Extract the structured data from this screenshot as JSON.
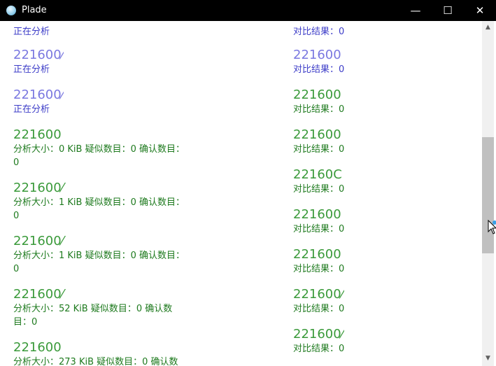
{
  "window": {
    "title": "Plade"
  },
  "colors": {
    "blue": "#3c3cc8",
    "title_blue": "#7a78e0",
    "green": "#1e7a1e",
    "title_green": "#3a9a3a"
  },
  "left_items": [
    {
      "title": "",
      "desc": "正在分析",
      "color": "blue"
    },
    {
      "title": "221600⁄",
      "desc": "正在分析",
      "color": "blue"
    },
    {
      "title": "221600⁄",
      "desc": "正在分析",
      "color": "blue"
    },
    {
      "title": "221600",
      "desc": "分析大小：0 KiB  疑似数目：0  确认数目：0",
      "color": "green"
    },
    {
      "title": "221600⁄",
      "desc": "分析大小：1 KiB  疑似数目：0  确认数目：0",
      "color": "green"
    },
    {
      "title": "221600⁄",
      "desc": "分析大小：1 KiB  疑似数目：0  确认数目：0",
      "color": "green"
    },
    {
      "title": "221600⁄",
      "desc": "分析大小：52 KiB  疑似数目：0  确认数目：0",
      "color": "green"
    },
    {
      "title": "221600",
      "desc": "分析大小：273 KiB  疑似数目：0  确认数",
      "color": "green"
    }
  ],
  "right_items": [
    {
      "title": "",
      "desc": "对比结果：0",
      "color": "blue"
    },
    {
      "title": "221600",
      "desc": "对比结果：0",
      "color": "blue"
    },
    {
      "title": "221600",
      "desc": "对比结果：0",
      "color": "green"
    },
    {
      "title": "221600",
      "desc": "对比结果：0",
      "color": "green"
    },
    {
      "title": "22160C",
      "desc": "对比结果：0",
      "color": "green"
    },
    {
      "title": "221600",
      "desc": "对比结果：0",
      "color": "green"
    },
    {
      "title": "221600",
      "desc": "对比结果：0",
      "color": "green"
    },
    {
      "title": "221600⁄",
      "desc": "对比结果：0",
      "color": "green"
    },
    {
      "title": "221600⁄",
      "desc": "对比结果：0",
      "color": "green"
    }
  ]
}
